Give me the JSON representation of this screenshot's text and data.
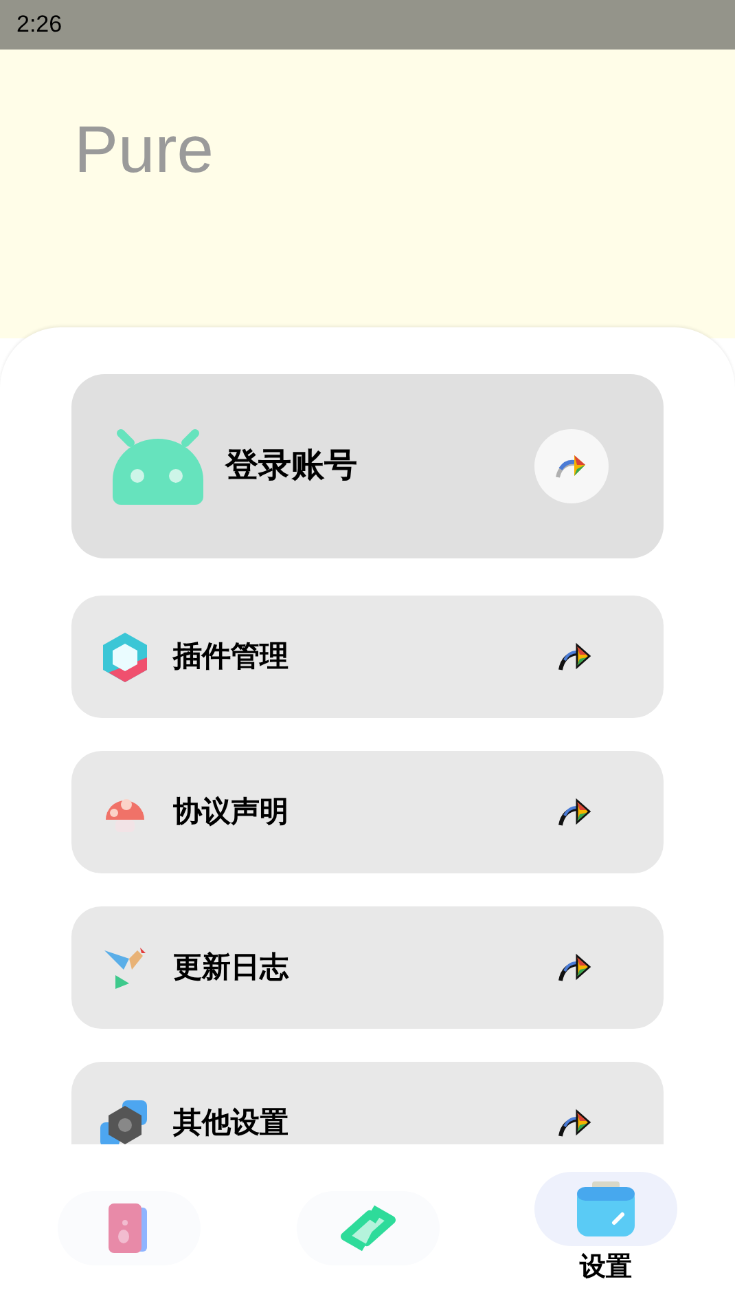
{
  "status_bar": {
    "time": "2:26"
  },
  "header": {
    "title": "Pure"
  },
  "login_card": {
    "label": "登录账号"
  },
  "menu_items": [
    {
      "label": "插件管理"
    },
    {
      "label": "协议声明"
    },
    {
      "label": "更新日志"
    },
    {
      "label": "其他设置"
    }
  ],
  "bottom_nav": [
    {
      "selected": false
    },
    {
      "selected": false
    },
    {
      "selected": true,
      "label": "设置"
    }
  ]
}
